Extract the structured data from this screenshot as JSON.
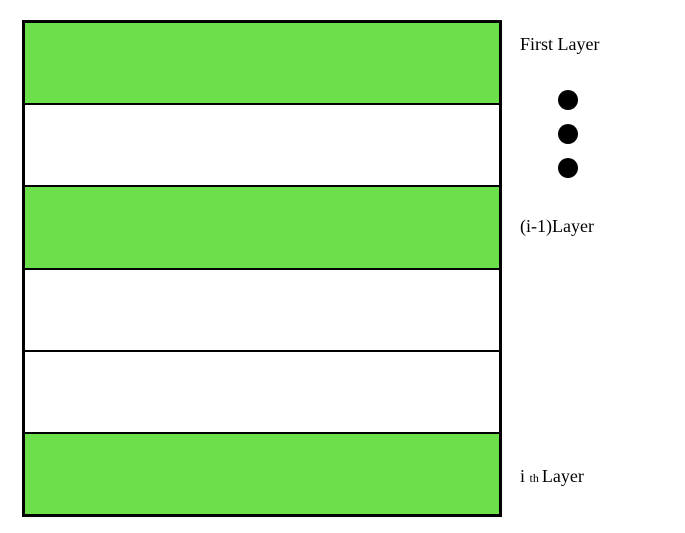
{
  "labels": {
    "first": "First Layer",
    "minus1": "(i-1)Layer",
    "ith_i": "i ",
    "ith_th": "th ",
    "ith_layer": "Layer"
  },
  "layers": {
    "rows": [
      {
        "color": "green"
      },
      {
        "color": "white"
      },
      {
        "color": "green"
      },
      {
        "color": "white"
      },
      {
        "color": "white"
      },
      {
        "color": "green"
      }
    ]
  },
  "colors": {
    "green": "#6be04a",
    "white": "#ffffff",
    "border": "#000000"
  },
  "ellipsis_count": 3
}
